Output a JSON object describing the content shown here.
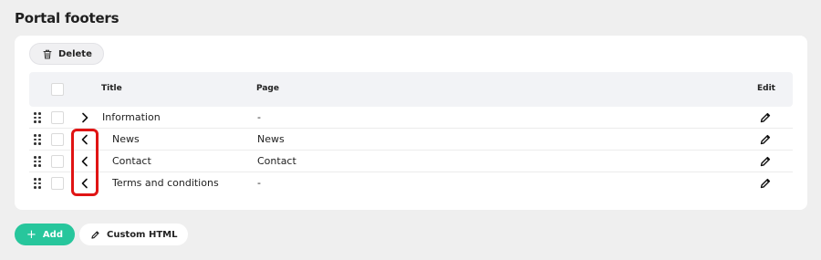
{
  "page": {
    "title": "Portal footers"
  },
  "toolbar": {
    "delete_label": "Delete",
    "delete_icon": "trash-icon"
  },
  "table": {
    "headers": {
      "title": "Title",
      "page": "Page",
      "edit": "Edit"
    },
    "rows": [
      {
        "title": "Information",
        "page": "-",
        "toggle_icon": "chevron-right-icon",
        "indent": false
      },
      {
        "title": "News",
        "page": "News",
        "toggle_icon": "chevron-left-icon",
        "indent": true
      },
      {
        "title": "Contact",
        "page": "Contact",
        "toggle_icon": "chevron-left-icon",
        "indent": true
      },
      {
        "title": "Terms and conditions",
        "page": "-",
        "toggle_icon": "chevron-left-icon",
        "indent": true
      }
    ]
  },
  "footer": {
    "add_label": "Add",
    "custom_html_label": "Custom HTML"
  },
  "colors": {
    "accent": "#27c69c",
    "highlight": "#e01414",
    "background": "#efefef"
  }
}
